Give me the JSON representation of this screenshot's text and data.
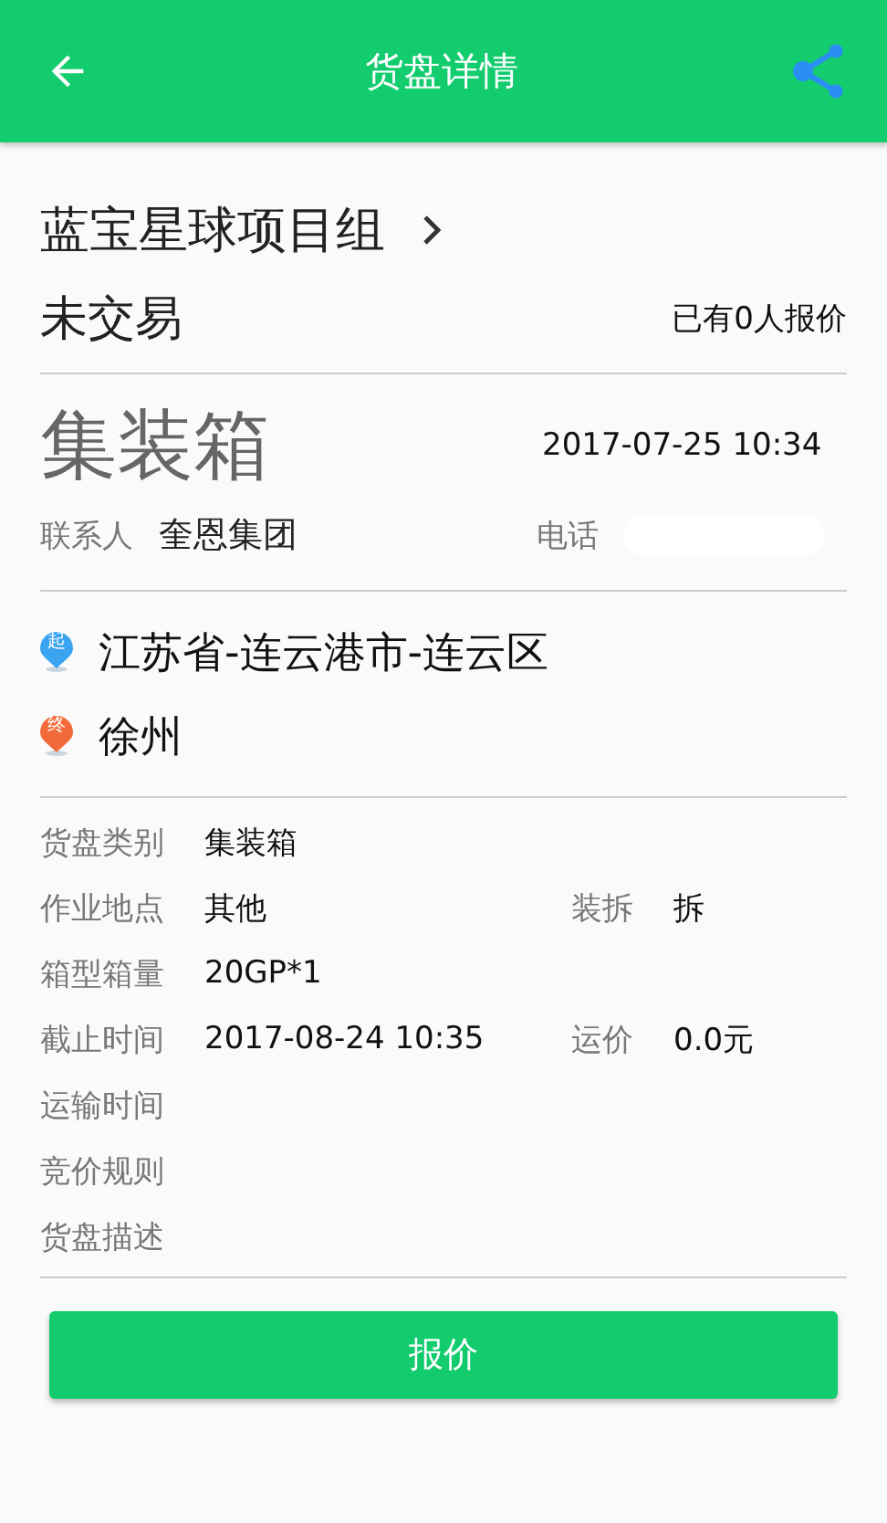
{
  "header": {
    "title": "货盘详情"
  },
  "company": {
    "name": "蓝宝星球项目组"
  },
  "status": "未交易",
  "quote_count": "已有0人报价",
  "cargo_type": "集装箱",
  "date": "2017-07-25 10:34",
  "contact": {
    "label": "联系人",
    "value": "奎恩集团"
  },
  "phone": {
    "label": "电话",
    "redacted": true
  },
  "route": [
    {
      "marker": "起",
      "color": "#3ba4f0",
      "place": "江苏省-连云港市-连云区"
    },
    {
      "marker": "终",
      "color": "#f26a3a",
      "place": "徐州"
    }
  ],
  "details": [
    [
      {
        "label": "货盘类别",
        "value": "集装箱"
      }
    ],
    [
      {
        "label": "作业地点",
        "value": "其他"
      },
      {
        "label": "装拆",
        "value": "拆"
      }
    ],
    [
      {
        "label": "箱型箱量",
        "value": "20GP*1"
      }
    ],
    [
      {
        "label": "截止时间",
        "value": "2017-08-24 10:35"
      },
      {
        "label": "运价",
        "value": "0.0元"
      }
    ],
    [
      {
        "label": "运输时间"
      }
    ],
    [
      {
        "label": "竞价规则"
      }
    ],
    [
      {
        "label": "货盘描述"
      }
    ]
  ],
  "button": "报价"
}
